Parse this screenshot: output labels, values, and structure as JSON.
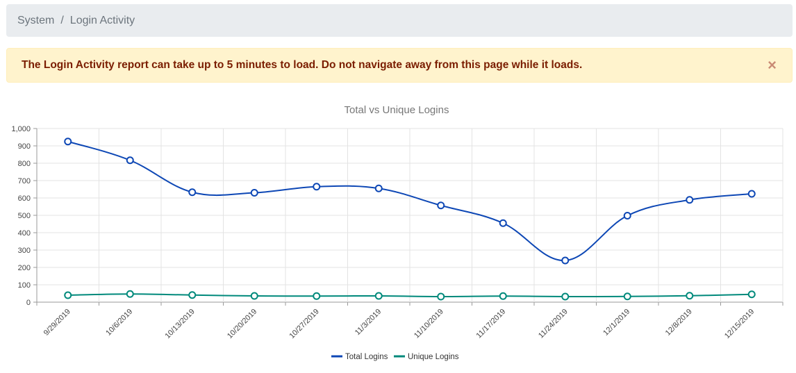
{
  "breadcrumb": {
    "items": [
      "System",
      "Login Activity"
    ],
    "separator": "/"
  },
  "alert": {
    "message": "The Login Activity report can take up to 5 minutes to load. Do not navigate away from this page while it loads.",
    "close_symbol": "×"
  },
  "chart_data": {
    "type": "line",
    "title": "Total vs Unique Logins",
    "categories": [
      "9/29/2019",
      "10/6/2019",
      "10/13/2019",
      "10/20/2019",
      "10/27/2019",
      "11/3/2019",
      "11/10/2019",
      "11/17/2019",
      "11/24/2019",
      "12/1/2019",
      "12/8/2019",
      "12/15/2019"
    ],
    "series": [
      {
        "name": "Total Logins",
        "color": "#0d47b5",
        "values": [
          925,
          817,
          633,
          630,
          665,
          655,
          557,
          455,
          240,
          498,
          589,
          624
        ]
      },
      {
        "name": "Unique Logins",
        "color": "#00897b",
        "values": [
          40,
          47,
          41,
          36,
          35,
          36,
          32,
          35,
          32,
          33,
          37,
          45
        ]
      }
    ],
    "ylim": [
      0,
      1000
    ],
    "yticks": [
      "0",
      "100",
      "200",
      "300",
      "400",
      "500",
      "600",
      "700",
      "800",
      "900",
      "1,000"
    ],
    "grid": true,
    "legend_position": "bottom"
  }
}
